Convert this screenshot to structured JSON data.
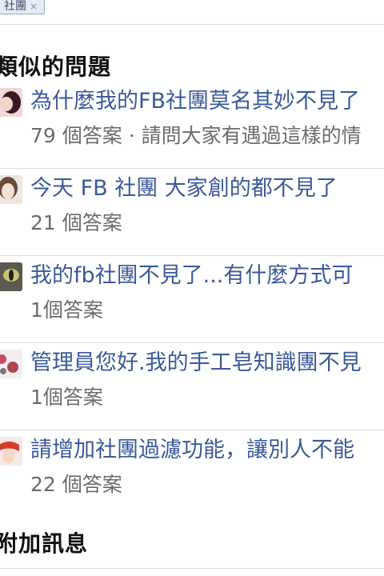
{
  "tag": {
    "label": "社團",
    "remove_glyph": "×"
  },
  "similar": {
    "title": "類似的問題",
    "questions": [
      {
        "title": "為什麼我的FB社團莫名其妙不見了",
        "meta": "79 個答案 · 請問大家有遇過這樣的情",
        "avatar": "avatar-1"
      },
      {
        "title": "今天 FB 社團 大家創的都不見了",
        "meta": "21 個答案",
        "avatar": "avatar-2"
      },
      {
        "title": "我的fb社團不見了...有什麼方式可",
        "meta": "1個答案",
        "avatar": "avatar-3"
      },
      {
        "title": "管理員您好.我的手工皂知識團不見",
        "meta": "1個答案",
        "avatar": "avatar-4"
      },
      {
        "title": "請增加社團過濾功能，讓別人不能",
        "meta": "22 個答案",
        "avatar": "avatar-5"
      }
    ]
  },
  "additional": {
    "title": "附加訊息"
  }
}
